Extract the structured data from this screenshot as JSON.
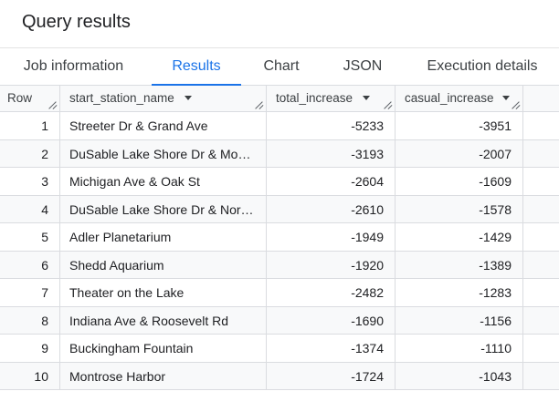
{
  "page": {
    "title": "Query results"
  },
  "tabs": [
    {
      "label": "Job information"
    },
    {
      "label": "Results",
      "active": true
    },
    {
      "label": "Chart"
    },
    {
      "label": "JSON"
    },
    {
      "label": "Execution details"
    }
  ],
  "table": {
    "columns": [
      {
        "label": "Row"
      },
      {
        "label": "start_station_name"
      },
      {
        "label": "total_increase"
      },
      {
        "label": "casual_increase"
      }
    ],
    "rows": [
      {
        "row": "1",
        "name": "Streeter Dr & Grand Ave",
        "total": "-5233",
        "casual": "-3951"
      },
      {
        "row": "2",
        "name": "DuSable Lake Shore Dr & Monro...",
        "total": "-3193",
        "casual": "-2007"
      },
      {
        "row": "3",
        "name": "Michigan Ave & Oak St",
        "total": "-2604",
        "casual": "-1609"
      },
      {
        "row": "4",
        "name": "DuSable Lake Shore Dr & North ...",
        "total": "-2610",
        "casual": "-1578"
      },
      {
        "row": "5",
        "name": "Adler Planetarium",
        "total": "-1949",
        "casual": "-1429"
      },
      {
        "row": "6",
        "name": "Shedd Aquarium",
        "total": "-1920",
        "casual": "-1389"
      },
      {
        "row": "7",
        "name": "Theater on the Lake",
        "total": "-2482",
        "casual": "-1283"
      },
      {
        "row": "8",
        "name": "Indiana Ave & Roosevelt Rd",
        "total": "-1690",
        "casual": "-1156"
      },
      {
        "row": "9",
        "name": "Buckingham Fountain",
        "total": "-1374",
        "casual": "-1110"
      },
      {
        "row": "10",
        "name": "Montrose Harbor",
        "total": "-1724",
        "casual": "-1043"
      }
    ]
  },
  "colors": {
    "accent": "#1a73e8",
    "border": "#dadce0",
    "stripe": "#f8f9fa"
  }
}
